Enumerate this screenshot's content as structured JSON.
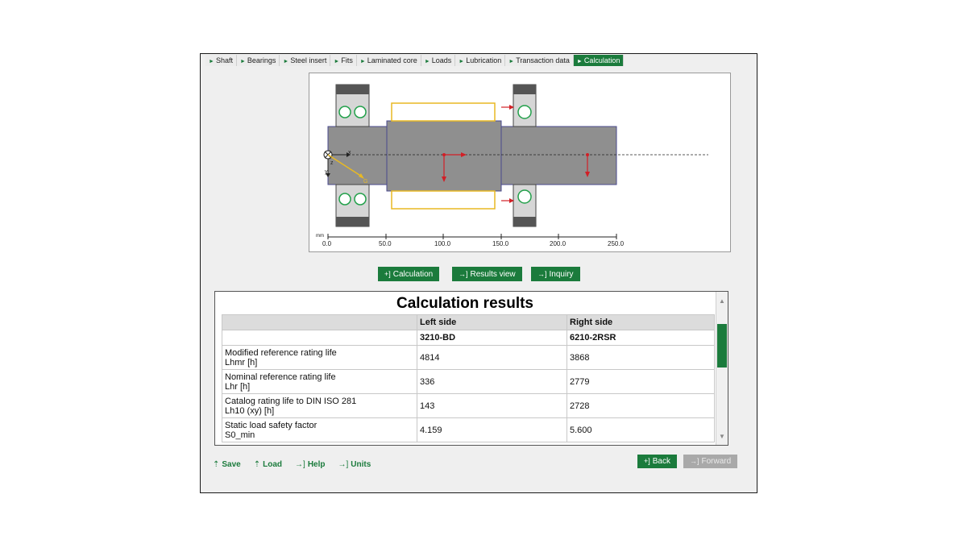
{
  "tabs": [
    {
      "label": "Shaft",
      "active": false
    },
    {
      "label": "Bearings",
      "active": false
    },
    {
      "label": "Steel insert",
      "active": false
    },
    {
      "label": "Fits",
      "active": false
    },
    {
      "label": "Laminated core",
      "active": false
    },
    {
      "label": "Loads",
      "active": false
    },
    {
      "label": "Lubrication",
      "active": false
    },
    {
      "label": "Transaction data",
      "active": false
    },
    {
      "label": "Calculation",
      "active": true
    }
  ],
  "diagram": {
    "unit": "mm",
    "scale_ticks": [
      "0.0",
      "50.0",
      "100.0",
      "150.0",
      "200.0",
      "250.0"
    ],
    "axis_labels": {
      "x": "x",
      "z": "z",
      "y": "y",
      "g": "G"
    },
    "colors": {
      "shaft": "#8f8f8f",
      "shaft_border": "#4a4a8c",
      "load": "#d21f26",
      "insert": "#e8b923",
      "bearing": "#22a04a"
    }
  },
  "buttons": {
    "calculation": "Calculation",
    "results_view": "Results view",
    "inquiry": "Inquiry",
    "back": "Back",
    "forward": "Forward"
  },
  "results": {
    "title": "Calculation results",
    "headers": [
      "",
      "Left side",
      "Right side"
    ],
    "designations": [
      "",
      "3210-BD",
      "6210-2RSR"
    ],
    "rows": [
      {
        "label1": "Modified reference rating life",
        "label2": "Lhmr [h]",
        "left": "4814",
        "right": "3868"
      },
      {
        "label1": "Nominal reference rating life",
        "label2": "Lhr [h]",
        "left": "336",
        "right": "2779"
      },
      {
        "label1": "Catalog rating life to DIN ISO 281",
        "label2": "Lh10 (xy) [h]",
        "left": "143",
        "right": "2728"
      },
      {
        "label1": "Static load safety factor",
        "label2": "S0_min",
        "left": "4.159",
        "right": "5.600"
      }
    ]
  },
  "footer_links": [
    "Save",
    "Load",
    "Help",
    "Units"
  ],
  "accent_color": "#1b7b3c"
}
